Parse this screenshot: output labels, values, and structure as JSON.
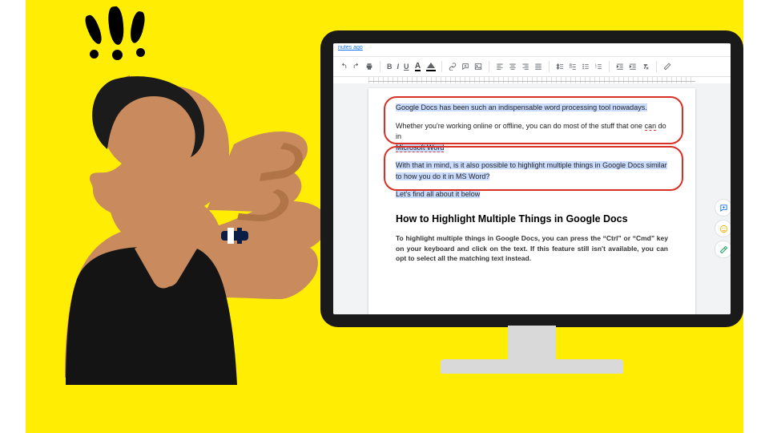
{
  "topstrip": {
    "last_edit": "nutes ago"
  },
  "toolbar": {
    "bold": "B",
    "italic": "I",
    "underline": "U",
    "textcolor": "A"
  },
  "doc": {
    "p1": "Google Docs has been such an indispensable word processing tool nowadays.",
    "p2a": "Whether you're working online or offline, you can do most of the stuff that one ",
    "p2b": "can",
    "p2c": " do in",
    "p2d": "Microsoft Word",
    "p3": "With that in mind, is it also possible to highlight multiple things in Google Docs similar to how you do it in MS Word?",
    "p4": "Let's find all about it below",
    "heading": "How to Highlight Multiple Things in Google Docs",
    "body": "To highlight multiple things in Google Docs, you can press the “Ctrl” or “Cmd” key on your keyboard and click on the text. If this feature still isn't available, you can opt to select all the matching text instead."
  }
}
